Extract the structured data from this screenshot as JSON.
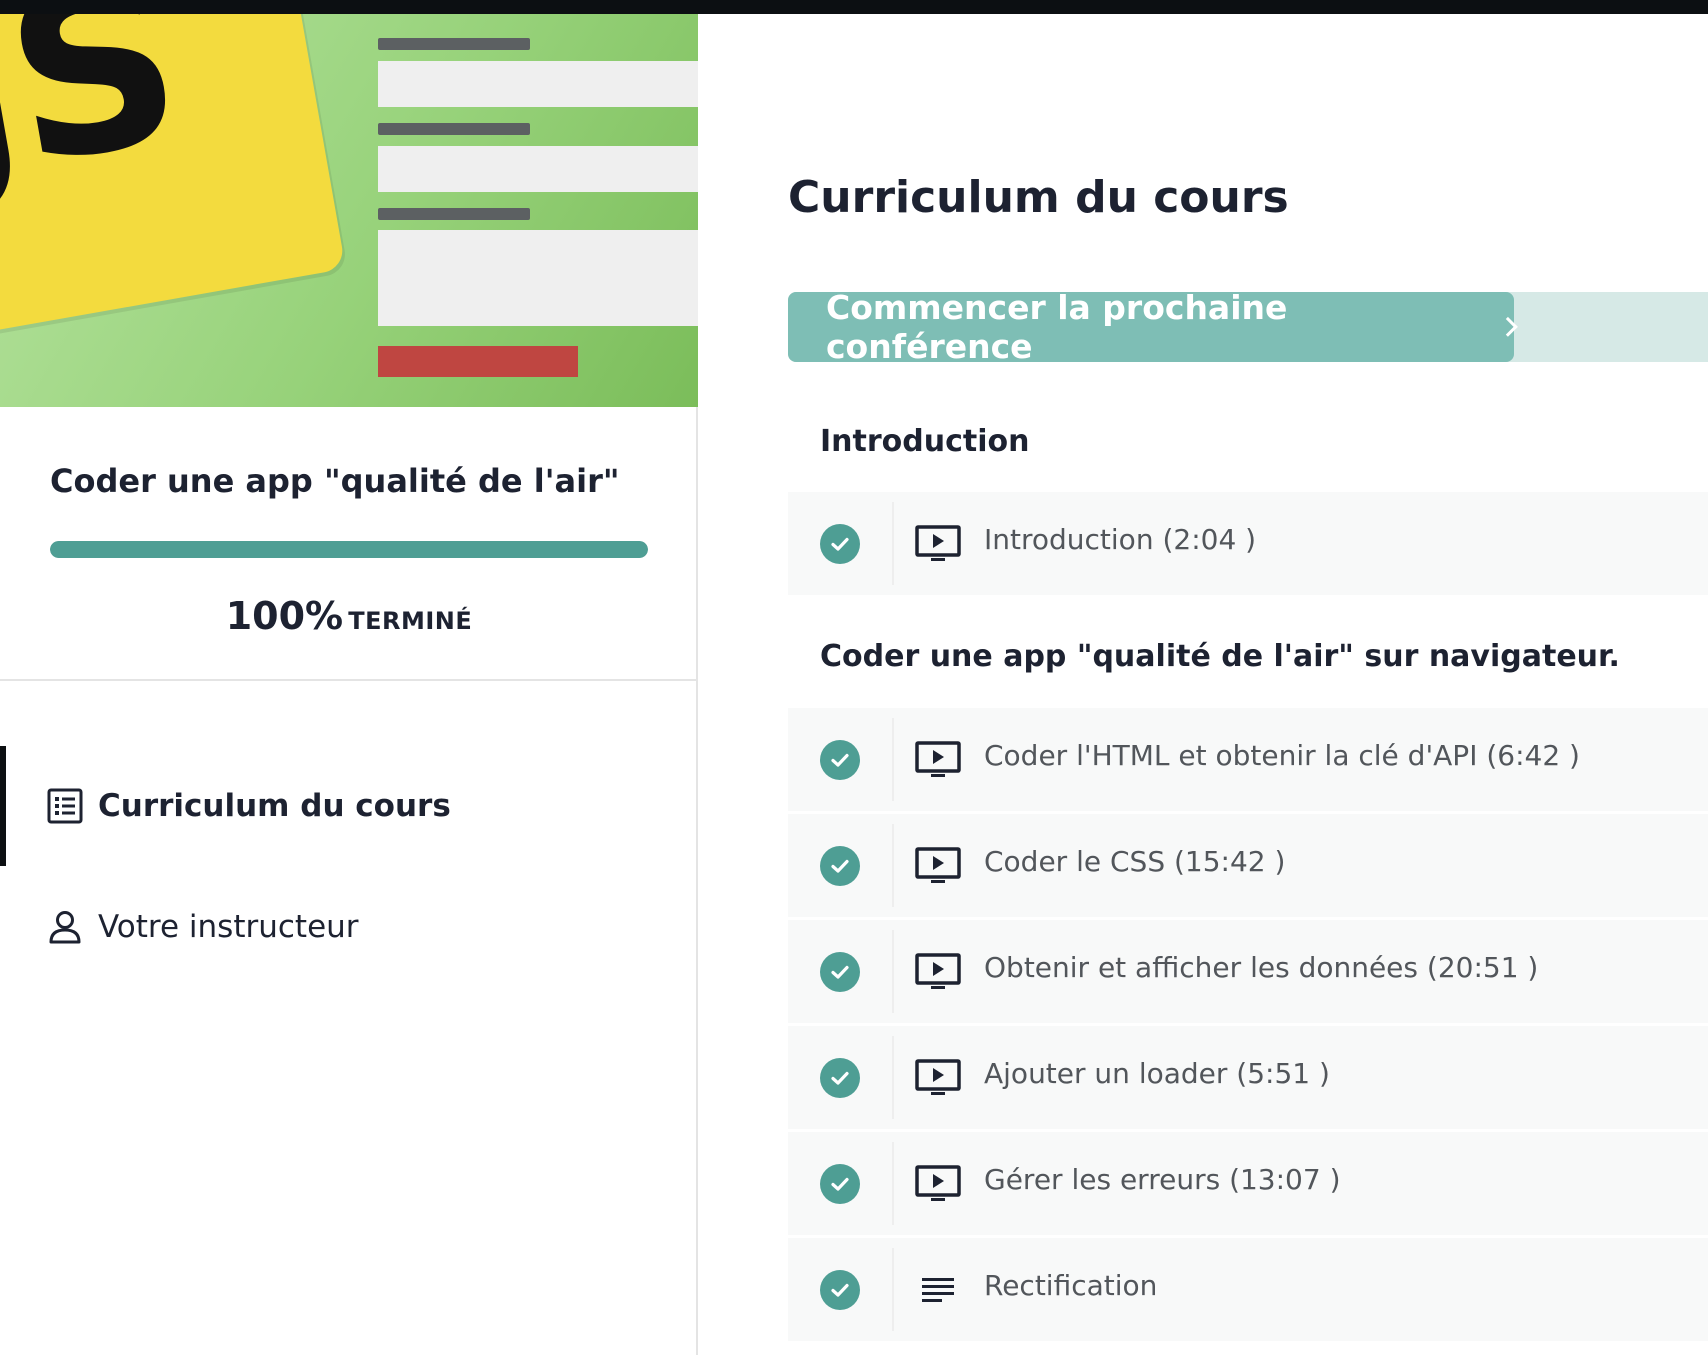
{
  "sidebar": {
    "course_title": "Coder une app \"qualité de l'air\"",
    "progress_value": 1.0,
    "progress_percent": "100%",
    "progress_word": "TERMINÉ",
    "nav": [
      {
        "label": "Curriculum du cours",
        "icon": "list-icon",
        "active": true
      },
      {
        "label": "Votre instructeur",
        "icon": "user-icon",
        "active": false
      }
    ],
    "hero_logo_text": "JS"
  },
  "main": {
    "page_title": "Curriculum du cours",
    "next_button_label": "Commencer la prochaine conférence",
    "sections": [
      {
        "title": "Introduction",
        "lectures": [
          {
            "label": "Introduction (2:04 )",
            "type": "video-icon",
            "completed": true
          }
        ]
      },
      {
        "title": "Coder une app \"qualité de l'air\" sur navigateur.",
        "lectures": [
          {
            "label": "Coder l'HTML et obtenir la clé d'API (6:42 )",
            "type": "video-icon",
            "completed": true
          },
          {
            "label": "Coder le CSS (15:42 )",
            "type": "video-icon",
            "completed": true
          },
          {
            "label": "Obtenir et afficher les données (20:51 )",
            "type": "video-icon",
            "completed": true
          },
          {
            "label": "Ajouter un loader (5:51 )",
            "type": "video-icon",
            "completed": true
          },
          {
            "label": "Gérer les erreurs (13:07 )",
            "type": "video-icon",
            "completed": true
          },
          {
            "label": "Rectification",
            "type": "text-icon",
            "completed": true
          }
        ]
      }
    ]
  },
  "colors": {
    "accent": "#4e9e94",
    "next_button": "#7ebeb5",
    "next_bar": "#d6e9e6",
    "text_dark": "#1d2231",
    "text_muted": "#52565b"
  }
}
